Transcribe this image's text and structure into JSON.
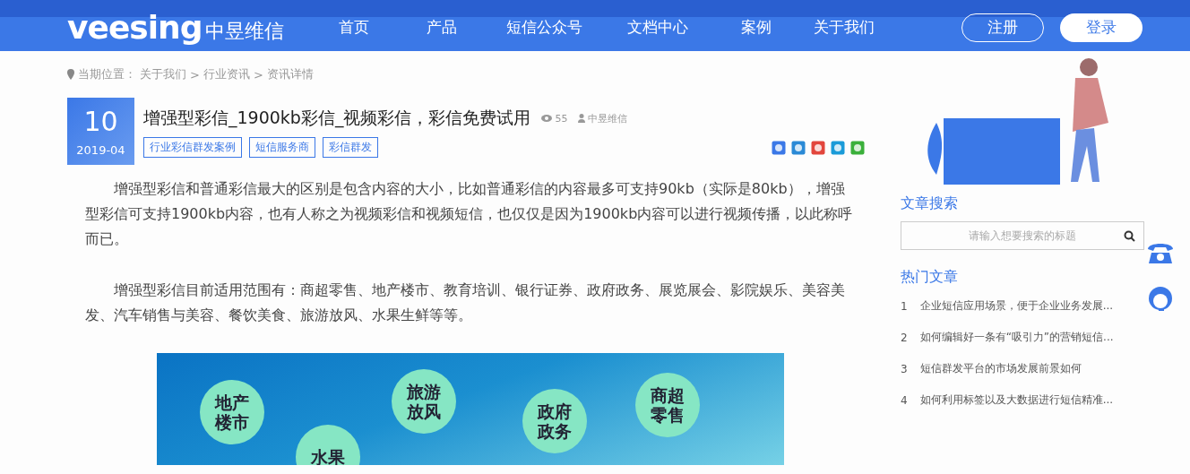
{
  "header": {
    "logo_latin": "veesing",
    "logo_cn": "中昱维信",
    "nav": [
      "首页",
      "产品",
      "短信公众号",
      "文档中心",
      "案例",
      "关于我们"
    ],
    "register": "注册",
    "login": "登录"
  },
  "breadcrumb": {
    "label": "当期位置：",
    "separator": ">",
    "items": [
      "关于我们",
      "行业资讯",
      "资讯详情"
    ]
  },
  "article": {
    "day": "10",
    "month": "2019-04",
    "title": "增强型彩信_1900kb彩信_视频彩信，彩信免费试用",
    "views": "55",
    "author": "中昱维信",
    "tags": [
      "行业彩信群发案例",
      "短信服务商",
      "彩信群发"
    ],
    "paragraphs": [
      "增强型彩信和普通彩信最大的区别是包含内容的大小，比如普通彩信的内容最多可支持90kb（实际是80kb），增强型彩信可支持1900kb内容，也有人称之为视频彩信和视频短信，也仅仅是因为1900kb内容可以进行视频传播，以此称呼而已。",
      "增强型彩信目前适用范围有：商超零售、地产楼市、教育培训、银行证券、政府政务、展览展会、影院娱乐、美容美发、汽车销售与美容、餐饮美食、旅游放风、水果生鲜等等。"
    ],
    "infographic": [
      "地产楼市",
      "旅游放风",
      "政府政务",
      "商超零售",
      "水果"
    ]
  },
  "sidebar": {
    "search_title": "文章搜索",
    "search_placeholder": "请输入想要搜索的标题",
    "hot_title": "热门文章",
    "hot": [
      {
        "rank": "1",
        "title": "企业短信应用场景，便于企业业务发展..."
      },
      {
        "rank": "2",
        "title": "如何编辑好一条有“吸引力”的营销短信..."
      },
      {
        "rank": "3",
        "title": "短信群发平台的市场发展前景如何"
      },
      {
        "rank": "4",
        "title": "如何利用标签以及大数据进行短信精准..."
      }
    ]
  }
}
